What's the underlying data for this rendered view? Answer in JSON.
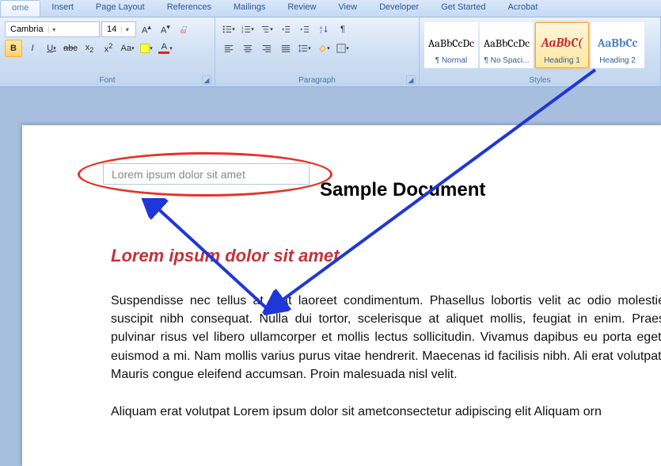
{
  "tabs": {
    "home": "ome",
    "insert": "Insert",
    "pageLayout": "Page Layout",
    "references": "References",
    "mailings": "Mailings",
    "review": "Review",
    "view": "View",
    "developer": "Developer",
    "getStarted": "Get Started",
    "acrobat": "Acrobat"
  },
  "font": {
    "name": "Cambria",
    "size": "14",
    "groupLabel": "Font"
  },
  "paragraph": {
    "groupLabel": "Paragraph"
  },
  "styles": {
    "groupLabel": "Styles",
    "items": [
      {
        "preview": "AaBbCcDc",
        "label": "¶ Normal",
        "color": "#000"
      },
      {
        "preview": "AaBbCcDc",
        "label": "¶ No Spaci...",
        "color": "#000"
      },
      {
        "preview": "AaBbC(",
        "label": "Heading 1",
        "color": "#c33238",
        "italic": true,
        "bold": true,
        "selected": true
      },
      {
        "preview": "AaBbCc",
        "label": "Heading 2",
        "color": "#4f81bd",
        "bold": true
      }
    ]
  },
  "nav": {
    "placeholder": "Lorem ipsum dolor sit amet"
  },
  "doc": {
    "title": "Sample Document",
    "h1": "Lorem ipsum dolor sit amet",
    "p1": "Suspendisse nec tellus at erat laoreet condimentum. Phasellus lobortis velit ac odio molestie suscipit nibh consequat. Nulla dui tortor, scelerisque at aliquet mollis, feugiat in enim. Praes  pulvinar risus vel libero ullamcorper et mollis lectus sollicitudin. Vivamus dapibus eu porta eget, euismod a mi. Nam mollis varius purus vitae hendrerit. Maecenas id facilisis  nibh. Ali erat volutpat. Mauris congue eleifend  accumsan. Proin malesuada nisl velit.",
    "p2": "Aliquam erat volutpat  Lorem ipsum dolor sit ametconsectetur adipiscing elit  Aliquam orn"
  }
}
